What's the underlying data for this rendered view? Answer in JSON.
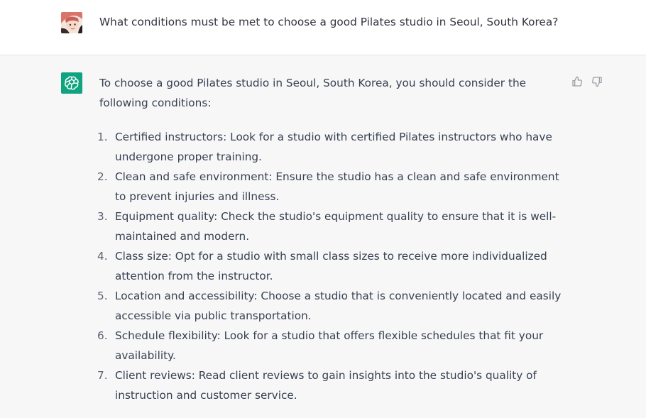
{
  "user_message": {
    "avatar": "user-avatar-photo",
    "text": "What conditions must be met to choose a good Pilates studio in Seoul, South Korea?"
  },
  "assistant_message": {
    "avatar": "openai-logo-icon",
    "intro": "To choose a good Pilates studio in Seoul, South Korea, you should consider the following conditions:",
    "items": [
      {
        "num": "1.",
        "text": "Certified instructors: Look for a studio with certified Pilates instructors who have undergone proper training."
      },
      {
        "num": "2.",
        "text": "Clean and safe environment: Ensure the studio has a clean and safe environment to prevent injuries and illness."
      },
      {
        "num": "3.",
        "text": "Equipment quality: Check the studio's equipment quality to ensure that it is well-maintained and modern."
      },
      {
        "num": "4.",
        "text": "Class size: Opt for a studio with small class sizes to receive more individualized attention from the instructor."
      },
      {
        "num": "5.",
        "text": "Location and accessibility: Choose a studio that is conveniently located and easily accessible via public transportation."
      },
      {
        "num": "6.",
        "text": "Schedule flexibility: Look for a studio that offers flexible schedules that fit your availability."
      },
      {
        "num": "7.",
        "text": "Client reviews: Read client reviews to gain insights into the studio's quality of instruction and customer service."
      }
    ],
    "feedback_icons": [
      "thumbs-up-icon",
      "thumbs-down-icon"
    ]
  },
  "colors": {
    "user_bg": "#ffffff",
    "assistant_bg": "#f7f7f8",
    "brand": "#10a37f",
    "text": "#374151"
  }
}
